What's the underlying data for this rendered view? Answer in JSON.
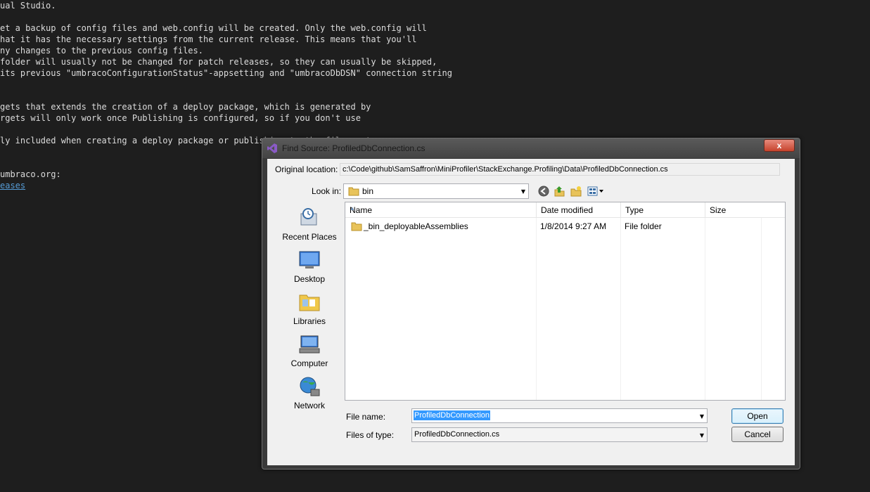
{
  "editor": {
    "lines": [
      "ual Studio.",
      "",
      "et a backup of config files and web.config will be created. Only the web.config will",
      "hat it has the necessary settings from the current release. This means that you'll",
      "ny changes to the previous config files.",
      "folder will usually not be changed for patch releases, so they can usually be skipped,",
      "its previous \"umbracoConfigurationStatus\"-appsetting and \"umbracoDbDSN\" connection string",
      "",
      "",
      "gets that extends the creation of a deploy package, which is generated by",
      "rgets will only work once Publishing is configured, so if you don't use",
      "",
      "ly included when creating a deploy package or publishing to the file system",
      "",
      "",
      "umbraco.org:"
    ],
    "link": "eases"
  },
  "dialog": {
    "title": "Find Source: ProfiledDbConnection.cs",
    "close_label": "x",
    "original_location_label": "Original location:",
    "original_location_value": "c:\\Code\\github\\SamSaffron\\MiniProfiler\\StackExchange.Profiling\\Data\\ProfiledDbConnection.cs",
    "look_in_label": "Look in:",
    "look_in_value": "bin",
    "places": [
      {
        "label": "Recent Places",
        "icon": "recent-places-icon"
      },
      {
        "label": "Desktop",
        "icon": "desktop-icon"
      },
      {
        "label": "Libraries",
        "icon": "libraries-icon"
      },
      {
        "label": "Computer",
        "icon": "computer-icon"
      },
      {
        "label": "Network",
        "icon": "network-icon"
      }
    ],
    "columns": [
      "Name",
      "Date modified",
      "Type",
      "Size"
    ],
    "rows": [
      {
        "name": "_bin_deployableAssemblies",
        "date": "1/8/2014 9:27 AM",
        "type": "File folder",
        "size": ""
      }
    ],
    "file_name_label": "File name:",
    "file_name_value": "ProfiledDbConnection",
    "files_of_type_label": "Files of type:",
    "files_of_type_value": "ProfiledDbConnection.cs",
    "open_label": "Open",
    "cancel_label": "Cancel"
  }
}
